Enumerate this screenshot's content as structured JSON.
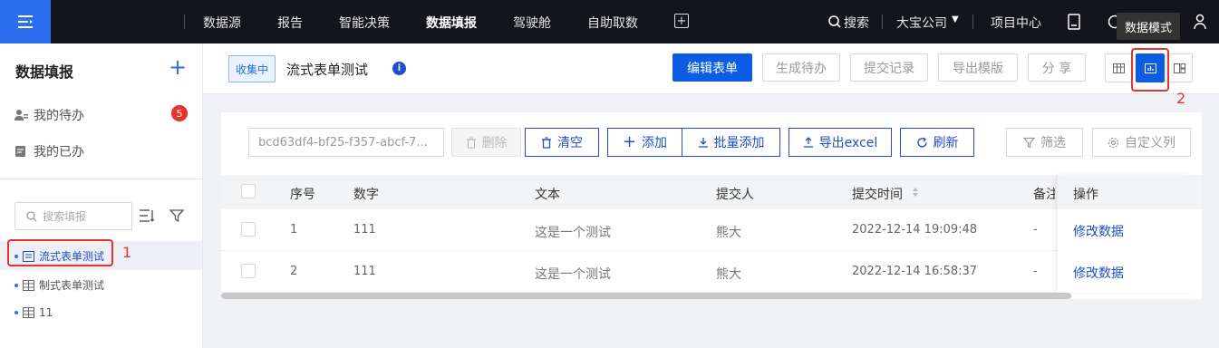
{
  "topnav": {
    "items": [
      "数据源",
      "报告",
      "智能决策",
      "数据填报",
      "驾驶舱",
      "自助取数"
    ],
    "active": "数据填报",
    "search": "搜索",
    "company": "大宝公司",
    "project_center": "项目中心",
    "tooltip": "数据模式"
  },
  "sidebar": {
    "title": "数据填报",
    "todo": "我的待办",
    "todo_badge": "5",
    "done": "我的已办",
    "search_placeholder": "搜索填报",
    "tree": [
      "流式表单测试",
      "制式表单测试",
      "11"
    ]
  },
  "header": {
    "status": "收集中",
    "title": "流式表单测试",
    "buttons": {
      "edit": "编辑表单",
      "generate": "生成待办",
      "history": "提交记录",
      "export_template": "导出模版",
      "share": "分 享"
    }
  },
  "toolbar": {
    "version": "bcd63df4-bf25-f357-abcf-7...",
    "delete": "删除",
    "clear": "清空",
    "add": "添加",
    "batch_add": "批量添加",
    "export_excel": "导出excel",
    "refresh": "刷新",
    "filter": "筛选",
    "custom_columns": "自定义列"
  },
  "table": {
    "headers": [
      "序号",
      "数字",
      "文本",
      "提交人",
      "提交时间",
      "备注",
      "操作"
    ],
    "rows": [
      {
        "seq": "1",
        "num": "111",
        "text": "这是一个测试",
        "user": "熊大",
        "time": "2022-12-14 19:09:48",
        "note": "-",
        "action": "修改数据"
      },
      {
        "seq": "2",
        "num": "111",
        "text": "这是一个测试",
        "user": "熊大",
        "time": "2022-12-14 16:58:37",
        "note": "-",
        "action": "修改数据"
      }
    ]
  },
  "annotations": {
    "one": "1",
    "two": "2"
  },
  "colors": {
    "accent": "#0d5ce6",
    "annotation": "#e8322d",
    "topbar": "#13151b"
  }
}
